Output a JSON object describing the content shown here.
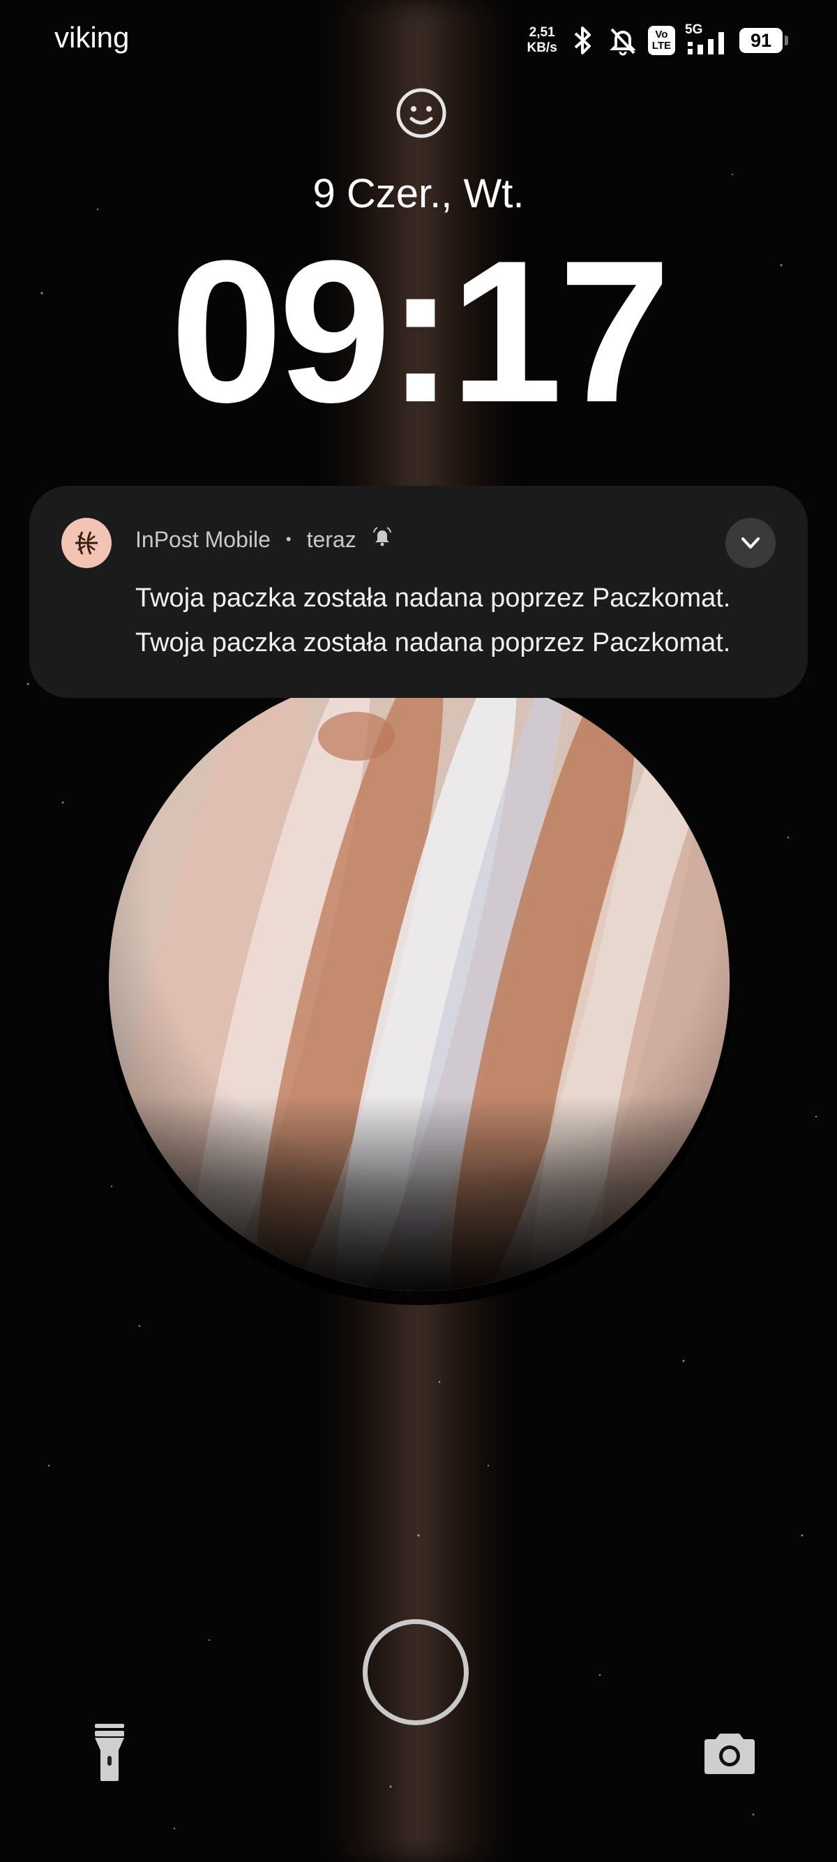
{
  "status_bar": {
    "carrier": "viking",
    "speed_value": "2,51",
    "speed_unit": "KB/s",
    "volte_top": "Vo",
    "volte_bottom": "LTE",
    "network": "5G",
    "battery": "91",
    "icons": [
      "bluetooth-icon",
      "mute-bell-icon",
      "volte-icon",
      "signal-icon",
      "battery-icon"
    ]
  },
  "lockscreen": {
    "date": "9 Czer., Wt.",
    "time": "09:17"
  },
  "notification": {
    "app_name": "InPost Mobile",
    "separator": "•",
    "when": "teraz",
    "line1": "Twoja paczka została nadana poprzez Paczkomat.",
    "line2": "Twoja paczka została nadana poprzez Paczkomat.",
    "icon_color": "#f2c4b3"
  },
  "controls": {
    "left": "flashlight-icon",
    "center": "fingerprint-unlock",
    "right": "camera-icon"
  }
}
